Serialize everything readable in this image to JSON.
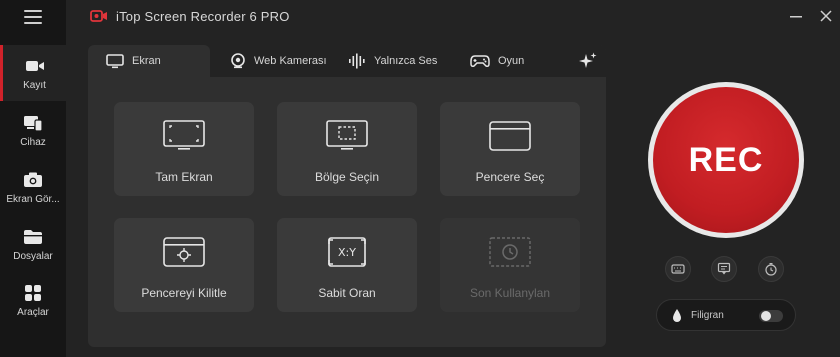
{
  "app": {
    "title": "iTop Screen Recorder 6 PRO",
    "accent_color": "#d0222a"
  },
  "sidebar": {
    "items": [
      {
        "label": "Kayıt",
        "icon": "camera-icon",
        "active": true
      },
      {
        "label": "Cihaz",
        "icon": "device-icon",
        "active": false
      },
      {
        "label": "Ekran Gör...",
        "icon": "screenshot-camera-icon",
        "active": false
      },
      {
        "label": "Dosyalar",
        "icon": "folder-icon",
        "active": false
      },
      {
        "label": "Araçlar",
        "icon": "tools-grid-icon",
        "active": false
      }
    ]
  },
  "tabs": [
    {
      "label": "Ekran",
      "icon": "monitor-icon",
      "active": true
    },
    {
      "label": "Web Kamerası",
      "icon": "webcam-icon",
      "active": false
    },
    {
      "label": "Yalnızca Ses",
      "icon": "audio-wave-icon",
      "active": false
    },
    {
      "label": "Oyun",
      "icon": "gamepad-icon",
      "active": false
    }
  ],
  "modes": [
    {
      "label": "Tam Ekran",
      "icon": "fullscreen-monitor-icon",
      "enabled": true
    },
    {
      "label": "Bölge Seçin",
      "icon": "region-monitor-icon",
      "enabled": true
    },
    {
      "label": "Pencere Seç",
      "icon": "window-icon",
      "enabled": true
    },
    {
      "label": "Pencereyi Kilitle",
      "icon": "lock-window-icon",
      "enabled": true
    },
    {
      "label": "Sabit Oran",
      "icon": "fixed-ratio-icon",
      "enabled": true
    },
    {
      "label": "Son Kullanylan",
      "icon": "history-icon",
      "enabled": false
    }
  ],
  "record": {
    "label": "REC",
    "color": "#c41f24"
  },
  "quick_buttons": [
    "keyboard-icon",
    "subtitle-icon",
    "timer-icon"
  ],
  "watermark": {
    "label": "Filigran",
    "enabled": false
  }
}
